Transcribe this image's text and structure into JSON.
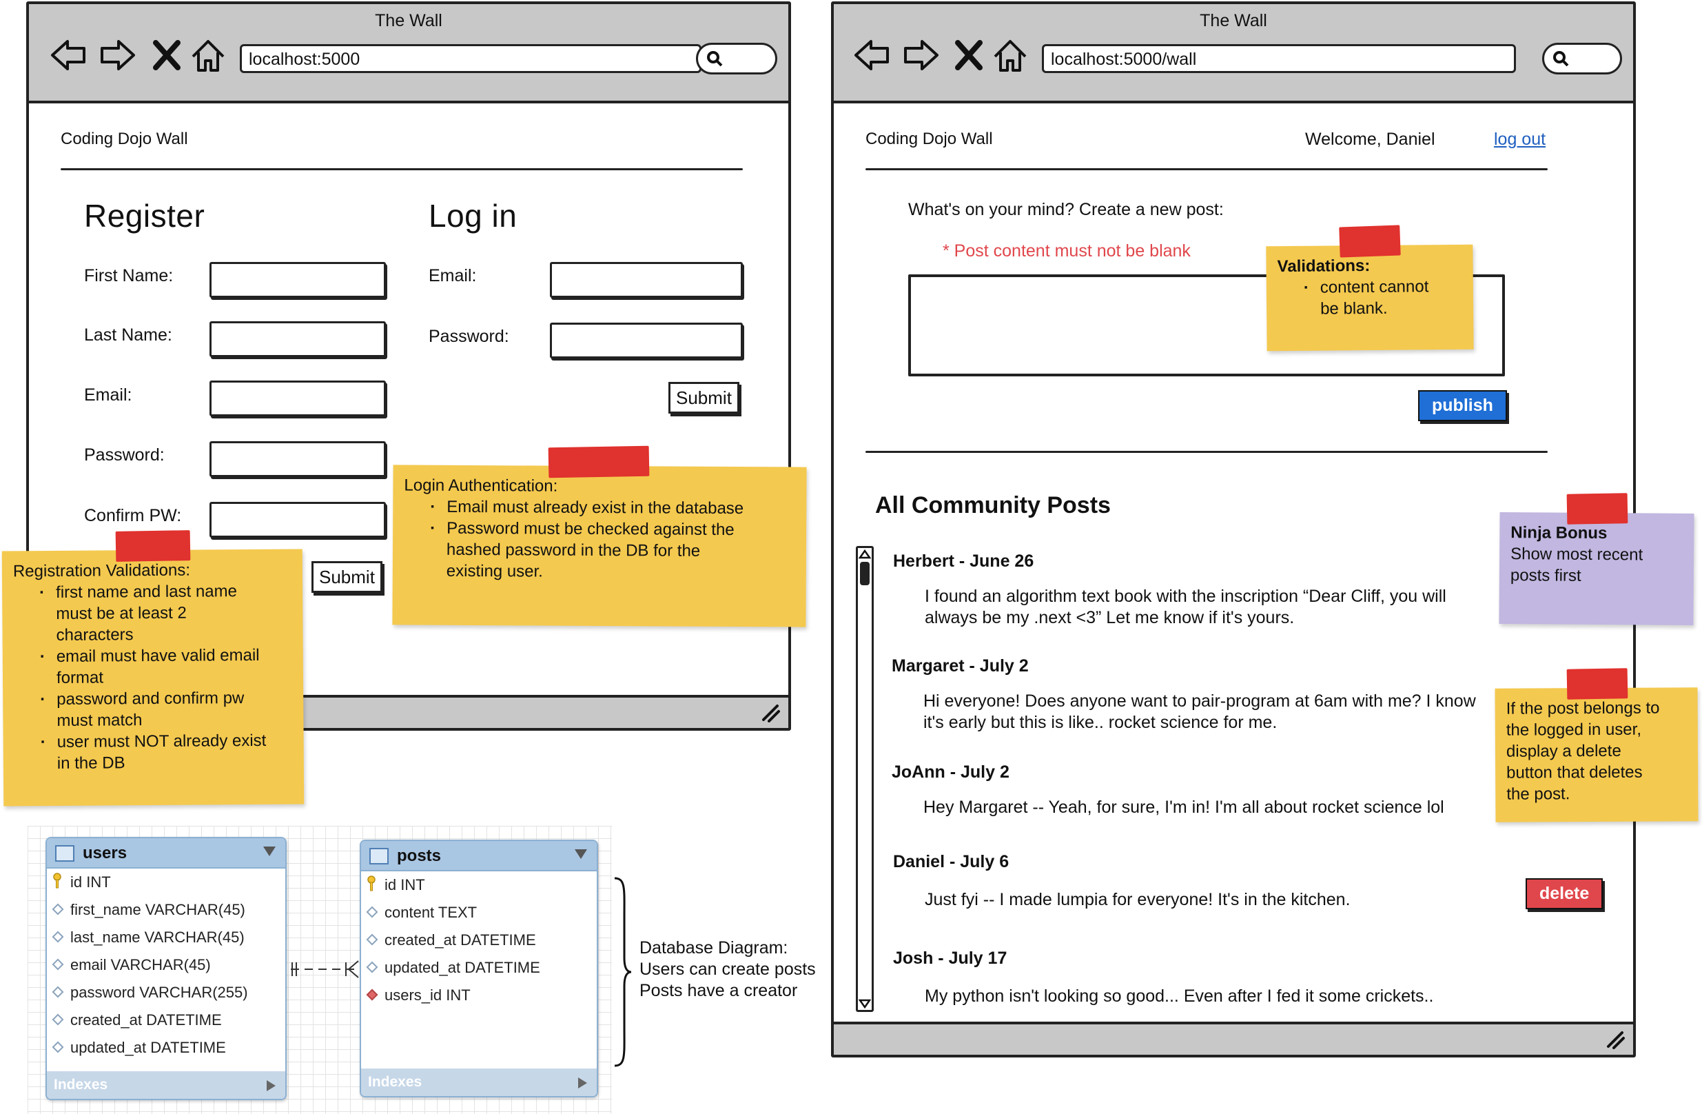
{
  "browser_left": {
    "title": "The Wall",
    "url": "localhost:5000",
    "brand": "Coding Dojo Wall",
    "register": {
      "heading": "Register",
      "first_name_label": "First Name:",
      "last_name_label": "Last Name:",
      "email_label": "Email:",
      "password_label": "Password:",
      "confirm_label": "Confirm PW:",
      "submit_label": "Submit"
    },
    "login": {
      "heading": "Log in",
      "email_label": "Email:",
      "password_label": "Password:",
      "submit_label": "Submit"
    }
  },
  "browser_right": {
    "title": "The Wall",
    "url": "localhost:5000/wall",
    "brand": "Coding Dojo Wall",
    "welcome": "Welcome, Daniel",
    "logout_label": "log out",
    "prompt": "What's on your mind? Create a new post:",
    "error": "* Post content must not be blank",
    "publish_label": "publish",
    "posts_heading": "All Community Posts",
    "delete_label": "delete",
    "posts": [
      {
        "header": "Herbert - June 26",
        "lines": [
          "I found an algorithm text book with the inscription “Dear Cliff, you will",
          "always be my .next <3” Let me know if it's yours."
        ]
      },
      {
        "header": "Margaret - July 2",
        "lines": [
          "Hi everyone! Does anyone want to pair-program at 6am with me? I know",
          "it's early but this is like.. rocket science for me."
        ]
      },
      {
        "header": "JoAnn - July 2",
        "lines": [
          "Hey Margaret -- Yeah, for sure, I'm in! I'm all about rocket science lol"
        ]
      },
      {
        "header": "Daniel - July 6",
        "lines": [
          "Just fyi -- I made lumpia for everyone! It's in the kitchen."
        ]
      },
      {
        "header": "Josh - July 17",
        "lines": [
          "My python isn't looking so good... Even after I fed it some crickets.."
        ]
      }
    ]
  },
  "notes": {
    "registration": {
      "title": "Registration Validations:",
      "items": [
        [
          "first name and last name",
          "must be at least 2",
          "characters"
        ],
        [
          "email must have valid email",
          "format"
        ],
        [
          "password and confirm pw",
          "must match"
        ],
        [
          "user must NOT already exist",
          "in the DB"
        ]
      ]
    },
    "login": {
      "title": "Login Authentication:",
      "items": [
        [
          "Email must already exist in the database"
        ],
        [
          "Password must be checked against the",
          "hashed password in the DB for the",
          "existing user."
        ]
      ]
    },
    "validations": {
      "title": "Validations:",
      "items": [
        [
          "content cannot",
          "be blank."
        ]
      ]
    },
    "ninja": {
      "title": "Ninja Bonus",
      "lines": [
        "Show most recent",
        "posts first"
      ]
    },
    "delete": {
      "lines": [
        "If the post belongs to",
        "the logged in user,",
        "display a delete",
        "button that deletes",
        "the post."
      ]
    }
  },
  "database": {
    "users": {
      "name": "users",
      "columns": [
        "id INT",
        "first_name VARCHAR(45)",
        "last_name VARCHAR(45)",
        "email VARCHAR(45)",
        "password VARCHAR(255)",
        "created_at DATETIME",
        "updated_at DATETIME"
      ],
      "footer": "Indexes"
    },
    "posts": {
      "name": "posts",
      "columns": [
        "id INT",
        "content TEXT",
        "created_at DATETIME",
        "updated_at DATETIME",
        "users_id INT"
      ],
      "footer": "Indexes"
    },
    "note": [
      "Database Diagram:",
      "Users can create posts",
      "Posts have a creator"
    ]
  }
}
